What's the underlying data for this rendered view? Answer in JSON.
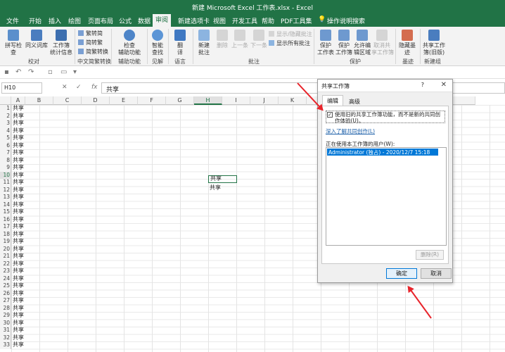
{
  "window": {
    "title": "新建 Microsoft Excel 工作表.xlsx - Excel"
  },
  "tabs": [
    "文件",
    "开始",
    "插入",
    "绘图",
    "页面布局",
    "公式",
    "数据",
    "审阅",
    "新建选项卡",
    "视图",
    "开发工具",
    "帮助",
    "PDF工具集",
    "操作说明搜索"
  ],
  "active_tab": "审阅",
  "ribbon": {
    "spell": "拼写检查",
    "thesaurus": "同义词库",
    "stats": "工作簿\n统计信息",
    "g_proof": "校对",
    "t2s": "繁转简",
    "s2t": "简转繁",
    "conv": "简繁转换",
    "g_chinese": "中文简繁转换",
    "access": "检查\n辅助功能",
    "g_access": "辅助功能",
    "smart": "智能\n查找",
    "g_insight": "见解",
    "translate": "翻\n译",
    "g_lang": "语言",
    "new_comment": "新建\n批注",
    "del": "删除",
    "prev": "上一条",
    "next": "下一条",
    "show_hide": "显示/隐藏批注",
    "show_all": "显示所有批注",
    "g_comments": "批注",
    "protect_sheet": "保护\n工作表",
    "protect_wb": "保护\n工作簿",
    "allow_edit": "允许编\n辑区域",
    "unshare": "取消共\n享工作簿",
    "g_protect": "保护",
    "hide_ink": "隐藏墨\n迹",
    "g_ink": "墨迹",
    "share_wb": "共享工作\n簿(旧版)",
    "g_newgroup": "新建组"
  },
  "formula_bar": {
    "name_box": "H10",
    "value": "共享"
  },
  "columns": [
    "A",
    "B",
    "C",
    "D",
    "E",
    "F",
    "G",
    "H",
    "I",
    "J",
    "K",
    "",
    "",
    "Q"
  ],
  "rows": [
    "1",
    "2",
    "3",
    "4",
    "5",
    "6",
    "7",
    "8",
    "9",
    "10",
    "11",
    "12",
    "13",
    "14",
    "15",
    "16",
    "17",
    "18",
    "19",
    "20",
    "21",
    "22",
    "23",
    "24",
    "25",
    "26",
    "27",
    "28",
    "29",
    "30",
    "31",
    "32",
    "33"
  ],
  "cell_text": "共享",
  "selected_cell": "H10",
  "dialog": {
    "title": "共享工作簿",
    "help": "?",
    "tab_edit": "编辑",
    "tab_advanced": "高级",
    "checkbox_label": "使用旧的共享工作簿功能，而不是新的共同创作体验(U)。",
    "checkbox_mark": "✓",
    "learn_more": "深入了解共同创作(L)",
    "users_label": "正在使用本工作簿的用户(W):",
    "users": [
      "Administrator (独占) - 2020/12/7 15:18"
    ],
    "remove": "删除(R)",
    "ok": "确定",
    "cancel": "取消"
  },
  "colors": {
    "excel_green": "#217346",
    "arrow_red": "#e8242b",
    "selection_blue": "#0078d7"
  }
}
